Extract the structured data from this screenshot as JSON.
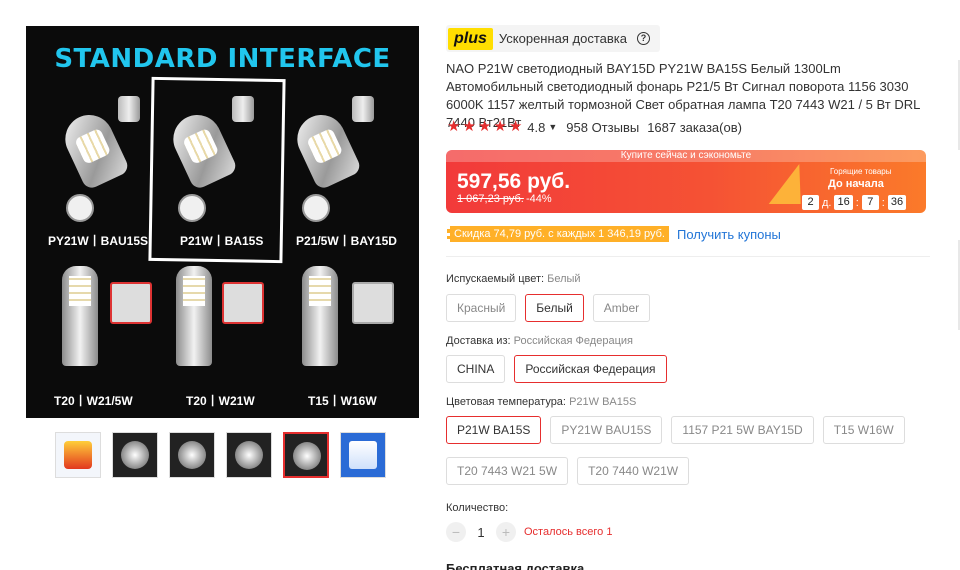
{
  "gallery": {
    "hero_title": "STANDARD INTERFACE",
    "labels": {
      "py21w": "PY21W丨BAU15S",
      "p21w": "P21W丨BA15S",
      "p21_5w": "P21/5W丨BAY15D",
      "t20_w21_5w": "T20丨W21/5W",
      "t20_w21w": "T20丨W21W",
      "t15_w16w": "T15丨W16W"
    },
    "thumb_count": 6,
    "selected_thumb": 5
  },
  "plus": {
    "logo": "plus",
    "text": "Ускоренная доставка",
    "help_icon": "question-circle-icon"
  },
  "product": {
    "title": "NAO P21W светодиодный BAY15D PY21W BA15S Белый 1300Lm Автомобильный светодиодный фонарь P21/5 Вт Сигнал поворота 1156 3030 6000K 1157 желтый тормозной Свет обратная лампа T20 7443 W21 / 5 Вт DRL 7440 Вт21Вт",
    "rating": "4.8",
    "stars": 5,
    "reviews": "958 Отзывы",
    "orders": "1687 заказа(ов)"
  },
  "price": {
    "promo_strip": "Купите сейчас и сэкономьте",
    "current": "597,56 руб.",
    "old": "1 067,23 руб.",
    "discount": "-44%",
    "goods_label": "Горящие товары",
    "countdown_label": "До начала",
    "days": "2",
    "days_unit": "д.",
    "hours": "16",
    "minutes": "7",
    "seconds": "36"
  },
  "coupon": {
    "tag": "Скидка 74,79 руб. с каждых 1 346,19 руб.",
    "link": "Получить купоны"
  },
  "color": {
    "label": "Испускаемый цвет:",
    "value": "Белый",
    "options": [
      "Красный",
      "Белый",
      "Amber"
    ]
  },
  "ship_from": {
    "label": "Доставка из:",
    "value": "Российская Федерация",
    "options": [
      "CHINA",
      "Российская Федерация"
    ]
  },
  "temperature": {
    "label": "Цветовая температура:",
    "value": "P21W BA15S",
    "options": [
      "P21W BA15S",
      "PY21W BAU15S",
      "1157 P21 5W BAY15D",
      "T15 W16W",
      "T20 7443 W21 5W",
      "T20 7440 W21W"
    ]
  },
  "quantity": {
    "label": "Количество:",
    "minus": "−",
    "value": "1",
    "plus": "+",
    "stock": "Осталось всего 1"
  },
  "shipping": {
    "title": "Бесплатная доставка"
  },
  "colors": {
    "accent": "#e62e2e",
    "link": "#2275d7",
    "plus_yellow": "#ffde00",
    "coupon_orange": "#ffb028",
    "hero_cyan": "#21c6ee"
  }
}
